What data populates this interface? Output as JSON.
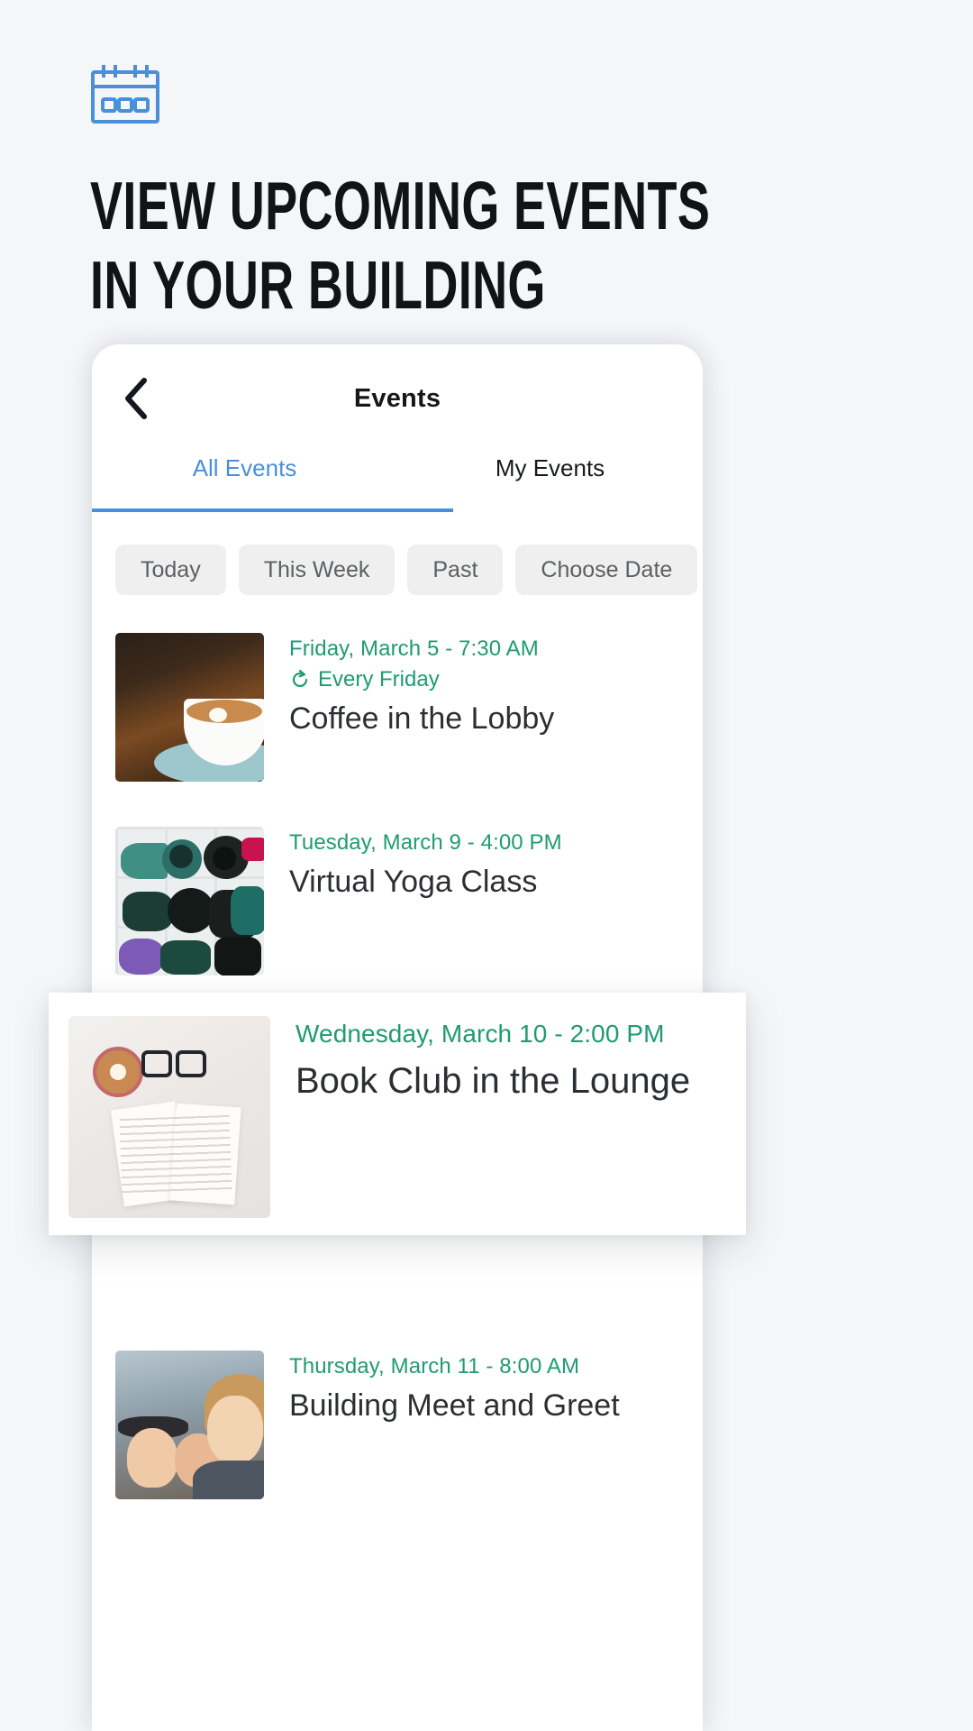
{
  "hero": {
    "icon": "calendar-icon",
    "icon_color": "#4a8fd9",
    "headline_line1": "VIEW UPCOMING EVENTS",
    "headline_line2": "IN YOUR BUILDING"
  },
  "phone": {
    "nav": {
      "back_icon": "chevron-left-icon",
      "title": "Events"
    },
    "tabs": [
      {
        "label": "All Events",
        "active": true
      },
      {
        "label": "My Events",
        "active": false
      }
    ],
    "filters": [
      {
        "label": "Today"
      },
      {
        "label": "This Week"
      },
      {
        "label": "Past"
      },
      {
        "label": "Choose Date"
      }
    ],
    "events": [
      {
        "date": "Friday, March 5 - 7:30 AM",
        "repeat_icon": "refresh-icon",
        "repeat": "Every Friday",
        "title": "Coffee in the Lobby",
        "thumb": "coffee-cup-photo"
      },
      {
        "date": "Tuesday, March 9 - 4:00 PM",
        "repeat": "",
        "title": "Virtual Yoga Class",
        "thumb": "yoga-mats-photo"
      },
      {
        "date": "Thursday, March 11 - 8:00 AM",
        "repeat": "",
        "title": "Building Meet and Greet",
        "thumb": "people-smiling-photo"
      }
    ]
  },
  "highlight": {
    "date": "Wednesday, March 10 - 2:00 PM",
    "title": "Book Club in the Lounge",
    "thumb": "open-book-latte-photo"
  },
  "colors": {
    "page_background": "#f4f6f8",
    "accent_blue": "#4a8fd9",
    "accent_green": "#1f9b72",
    "text_dark": "#16191d",
    "chip_background": "#efefef",
    "chip_text": "#5c5f63"
  }
}
